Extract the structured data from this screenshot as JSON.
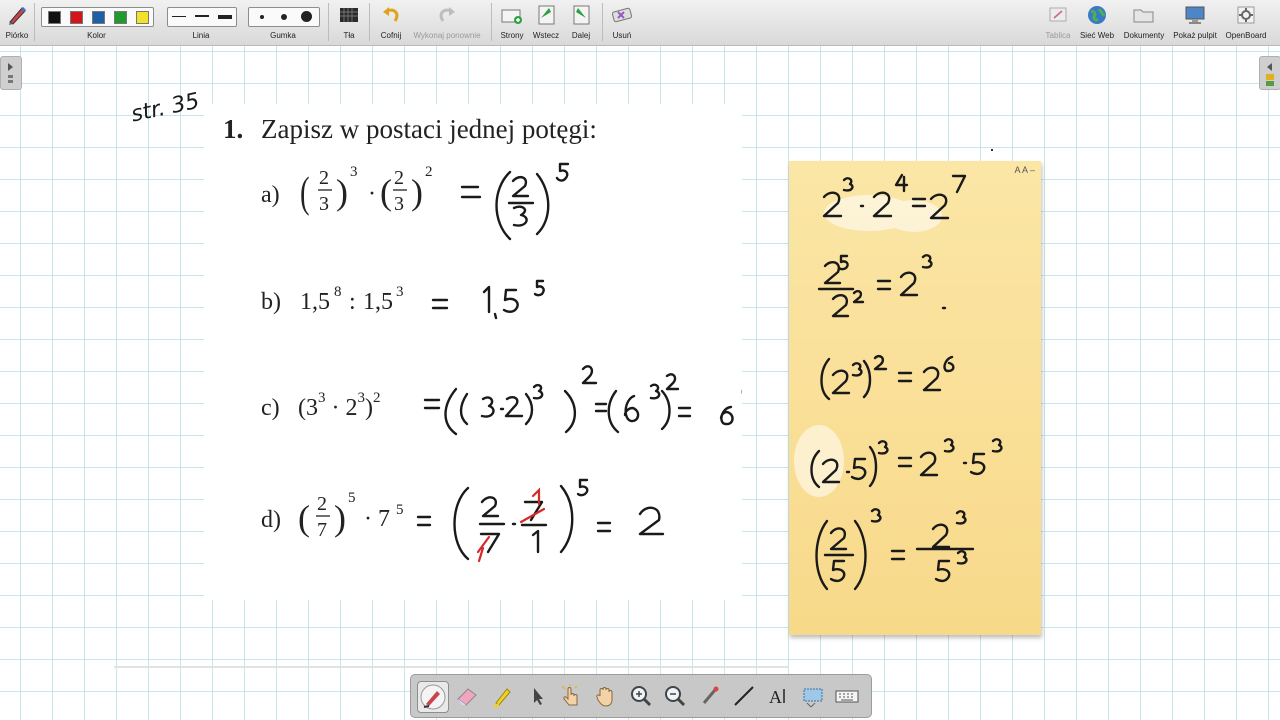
{
  "toolbar": {
    "pen_label": "Piórko",
    "color_label": "Kolor",
    "line_label": "Linia",
    "eraser_label": "Gumka",
    "background_label": "Tła",
    "undo_label": "Cofnij",
    "redo_label": "Wykonaj ponownie",
    "pages_label": "Strony",
    "back_label": "Wstecz",
    "next_label": "Dalej",
    "delete_label": "Usuń",
    "board_label": "Tablica",
    "web_label": "Sieć Web",
    "documents_label": "Dokumenty",
    "desktop_label": "Pokaż pulpit",
    "openboard_label": "OpenBoard",
    "colors": [
      "#111111",
      "#d4141a",
      "#1f5fa8",
      "#1f9a2d",
      "#f2e22a"
    ]
  },
  "board": {
    "page_note": "str. 35",
    "exercise_number": "1.",
    "exercise_title": "Zapisz w postaci jednej potęgi:",
    "items": [
      {
        "label": "a)",
        "answer": "= (2/3)^5"
      },
      {
        "label": "b)",
        "expression": "1,5",
        "exp1": "8",
        "op": ":",
        "exp2": "3",
        "answer": "= 1,5^5"
      },
      {
        "label": "c)",
        "answer": "= ((3·2)^3)^2 = (6^3)^2 = 6^6"
      },
      {
        "label": "d)",
        "answer": "= (2/7 · 7/1)^5 = 2"
      }
    ]
  },
  "sticky_note": {
    "font_controls": "A A –",
    "rules": [
      "2³·2⁴ = 2⁷",
      "2⁵/2² = 2³",
      "(2³)² = 2⁶",
      "(2·5)³ = 2³·5³",
      "(2/5)³ = 2³/5³"
    ]
  },
  "bottom_tools": [
    "pen-tool",
    "eraser-tool",
    "highlighter-tool",
    "select-tool",
    "interact-tool",
    "hand-tool",
    "zoom-in-tool",
    "zoom-out-tool",
    "laser-tool",
    "line-tool",
    "text-tool",
    "capture-tool",
    "keyboard-tool"
  ]
}
